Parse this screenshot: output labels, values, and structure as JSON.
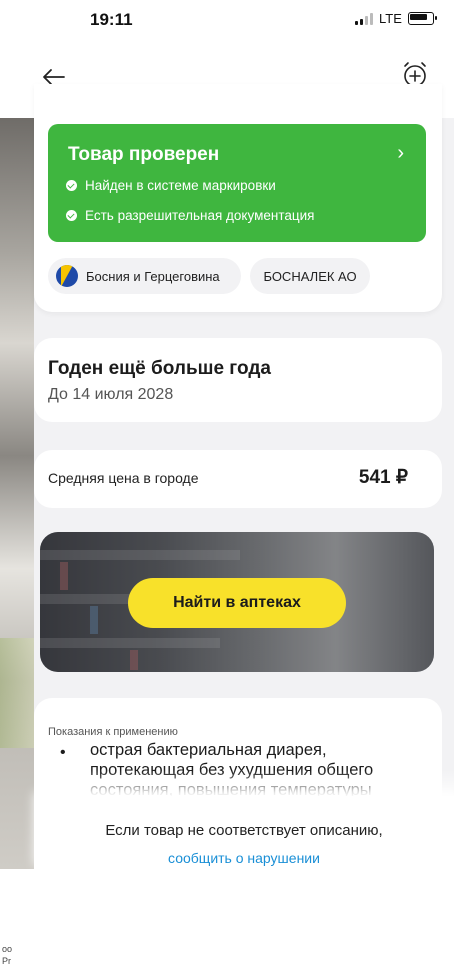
{
  "status_bar": {
    "time": "19:11",
    "network": "LTE"
  },
  "nav": {
    "back_icon": "arrow-left-icon",
    "alarm_icon": "alarm-plus-icon"
  },
  "verification": {
    "title": "Товар проверен",
    "chevron": "›",
    "items": [
      "Найден в системе маркировки",
      "Есть разрешительная документация"
    ],
    "color": "#3fb63f"
  },
  "origin": {
    "country": "Босния и Герцеговина",
    "manufacturer": "БОСНАЛЕК АО"
  },
  "expiry": {
    "title": "Годен ещё больше года",
    "subtitle": "До 14 июля 2028"
  },
  "price": {
    "label": "Средняя цена в городе",
    "value": "541 ₽"
  },
  "banner": {
    "button_label": "Найти в аптеках",
    "button_color": "#f8e12a"
  },
  "indications": {
    "label": "Показания к применению",
    "bullet": "•",
    "text": "острая бактериальная диарея, протекающая без ухудшения общего состояния, повышения температуры"
  },
  "report": {
    "text": "Если товар не соответствует описанию,",
    "link": "сообщить о нарушении",
    "link_color": "#1a8fd6"
  }
}
